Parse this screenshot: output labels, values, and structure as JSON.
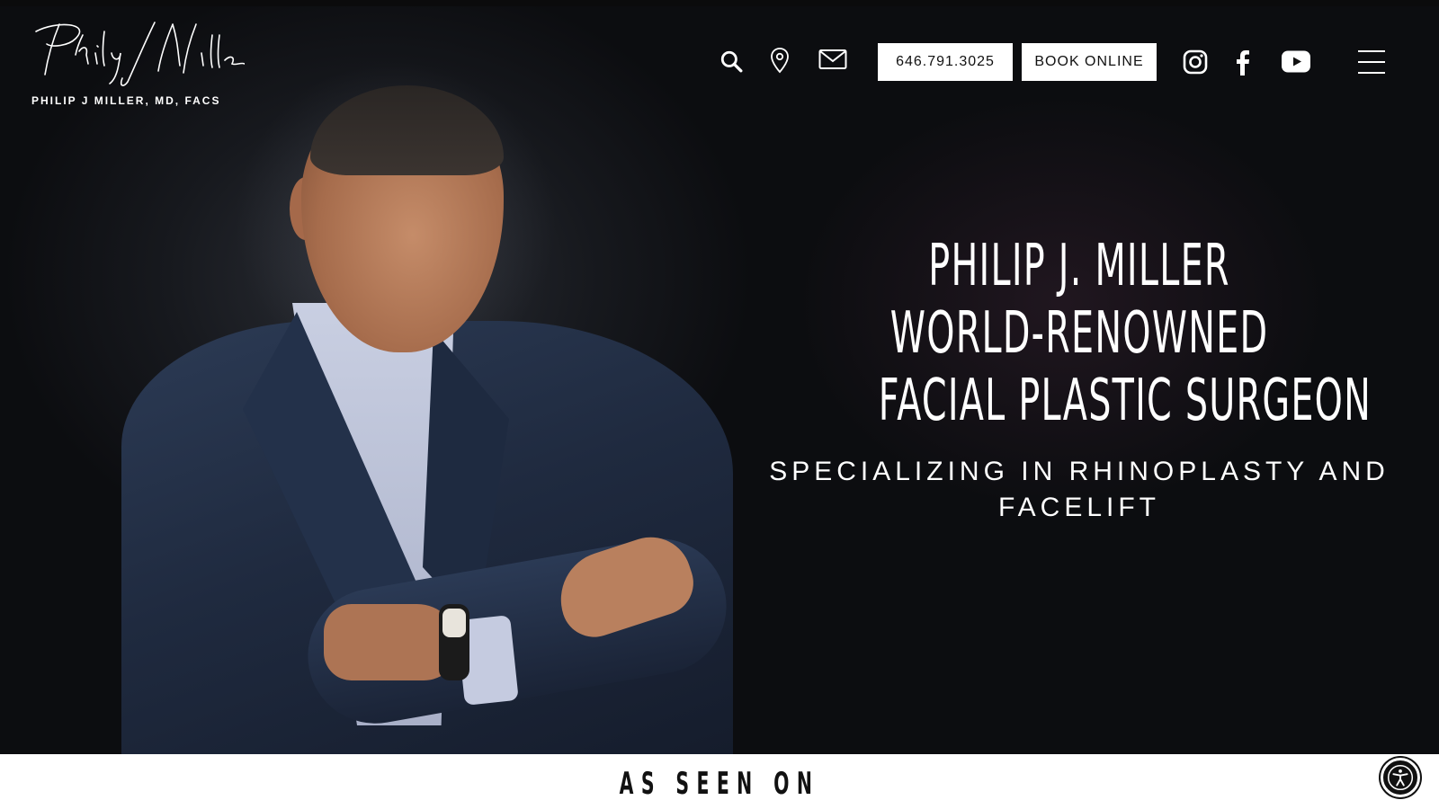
{
  "header": {
    "logo_signature_text": "Philip J Miller",
    "logo_subtitle": "PHILIP J MILLER, MD, FACS",
    "icons": [
      "search-icon",
      "location-pin-icon",
      "mail-icon",
      "instagram-icon",
      "facebook-icon",
      "youtube-icon",
      "hamburger-menu-icon"
    ],
    "phone_label": "646.791.3025",
    "book_label": "BOOK ONLINE"
  },
  "hero": {
    "headline_lines": [
      "PHILIP J. MILLER",
      "WORLD-RENOWNED",
      "FACIAL PLASTIC SURGEON"
    ],
    "subheadline": "SPECIALIZING IN RHINOPLASTY AND FACELIFT"
  },
  "below_fold": {
    "section_title": "AS SEEN ON"
  },
  "accessibility": {
    "icon": "accessibility-icon"
  },
  "colors": {
    "hero_background": "#0f1014",
    "button_background": "#ffffff",
    "text_light": "#ffffff",
    "text_dark": "#111111"
  }
}
